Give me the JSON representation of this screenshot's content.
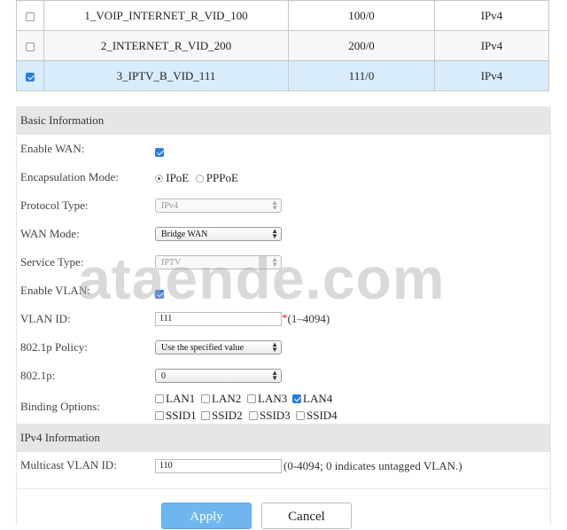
{
  "wan_list": [
    {
      "name": "1_VOIP_INTERNET_R_VID_100",
      "vlan": "100/0",
      "ip": "IPv4",
      "selected": false
    },
    {
      "name": "2_INTERNET_R_VID_200",
      "vlan": "200/0",
      "ip": "IPv4",
      "selected": false
    },
    {
      "name": "3_IPTV_B_VID_111",
      "vlan": "111/0",
      "ip": "IPv4",
      "selected": true
    }
  ],
  "basic": {
    "title": "Basic Information",
    "enable_wan_label": "Enable WAN:",
    "encap_label": "Encapsulation Mode:",
    "encap_ipoe": "IPoE",
    "encap_pppoe": "PPPoE",
    "protocol_label": "Protocol Type:",
    "protocol_value": "IPv4",
    "wan_mode_label": "WAN Mode:",
    "wan_mode_value": "Bridge WAN",
    "service_label": "Service Type:",
    "service_value": "IPTV",
    "enable_vlan_label": "Enable VLAN:",
    "vlan_id_label": "VLAN ID:",
    "vlan_id_value": "111",
    "vlan_id_req": "*",
    "vlan_id_hint": "(1–4094)",
    "policy_label": "802.1p Policy:",
    "policy_value": "Use the specified value",
    "p_label": "802.1p:",
    "p_value": "0",
    "binding_label": "Binding Options:",
    "binding": [
      {
        "label": "LAN1",
        "checked": false
      },
      {
        "label": "LAN2",
        "checked": false
      },
      {
        "label": "LAN3",
        "checked": false
      },
      {
        "label": "LAN4",
        "checked": true
      },
      {
        "label": "SSID1",
        "checked": false
      },
      {
        "label": "SSID2",
        "checked": false
      },
      {
        "label": "SSID3",
        "checked": false
      },
      {
        "label": "SSID4",
        "checked": false
      }
    ]
  },
  "ipv4": {
    "title": "IPv4 Information",
    "mcast_label": "Multicast VLAN ID:",
    "mcast_value": "110",
    "mcast_hint": "(0-4094; 0 indicates untagged VLAN.)"
  },
  "buttons": {
    "apply": "Apply",
    "cancel": "Cancel"
  },
  "watermark": "ataende.com",
  "colors": {
    "accent": "#2a7de1",
    "selected_row": "#d8ecfb",
    "apply_button": "#6fb6f0",
    "section_bg": "#e6e6e6",
    "required": "#e0282c"
  }
}
